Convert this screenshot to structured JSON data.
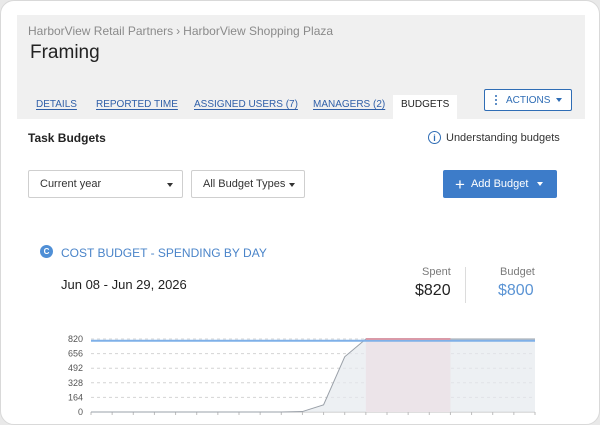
{
  "breadcrumb": {
    "client": "HarborView Retail Partners",
    "separator": "›",
    "project": "HarborView Shopping Plaza"
  },
  "page": {
    "title": "Framing"
  },
  "tabs": [
    {
      "label": "DETAILS",
      "active": false
    },
    {
      "label": "REPORTED TIME",
      "active": false
    },
    {
      "label": "ASSIGNED USERS (7)",
      "active": false
    },
    {
      "label": "MANAGERS (2)",
      "active": false
    },
    {
      "label": "BUDGETS",
      "active": true
    }
  ],
  "actions": {
    "label": "ACTIONS"
  },
  "section": {
    "title": "Task Budgets",
    "help_link": "Understanding budgets"
  },
  "filters": {
    "period": "Current year",
    "budget_type": "All Budget Types"
  },
  "add_budget": {
    "label": "Add Budget"
  },
  "budget_card": {
    "icon_letter": "C",
    "title": "COST BUDGET - SPENDING BY DAY",
    "date_range": "Jun 08 - Jun 29, 2026",
    "spent_label": "Spent",
    "spent_value": "$820",
    "budget_label": "Budget",
    "budget_value": "$800"
  },
  "colors": {
    "accent": "#3d7cc9",
    "budget_line": "#7fb0e8",
    "over_budget_fill": "#fbd7de",
    "spent_fill": "#e6e9ee",
    "spent_line": "#9aa0a8"
  },
  "chart_data": {
    "type": "area",
    "x": [
      0,
      1,
      2,
      3,
      4,
      5,
      6,
      7,
      8,
      9,
      10,
      11,
      12,
      13,
      14,
      15,
      16,
      17,
      18,
      19,
      20,
      21
    ],
    "series": [
      {
        "values": [
          0,
          0,
          0,
          0,
          0,
          0,
          0,
          0,
          0,
          0,
          5,
          80,
          620,
          820,
          820,
          820,
          820,
          820,
          820,
          820,
          820,
          820
        ]
      }
    ],
    "budget": 800,
    "yticks": [
      0,
      164,
      328,
      492,
      656,
      820
    ],
    "ylim": [
      0,
      820
    ],
    "grid": true,
    "over_budget_range": [
      13,
      17
    ]
  }
}
